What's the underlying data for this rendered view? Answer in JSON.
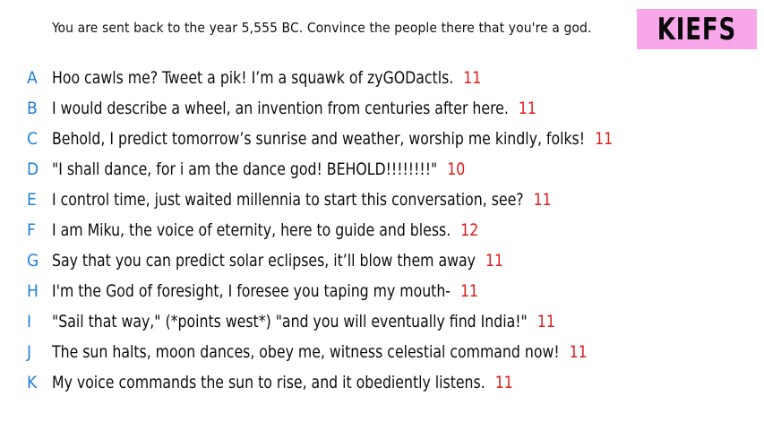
{
  "prompt": "You are sent back to the year 5,555 BC. Convince the people there that you're a god.",
  "badge": "KIEFS",
  "colors": {
    "letter": "#1f7fd9",
    "score": "#e01b1b",
    "badge_bg": "#f7a7ea"
  },
  "answers": [
    {
      "letter": "A",
      "text": "Hoo cawls me? Tweet a pik! I’m a squawk of zyGODactls.",
      "score": "11"
    },
    {
      "letter": "B",
      "text": "I would describe a wheel, an invention from centuries after here.",
      "score": "11"
    },
    {
      "letter": "C",
      "text": "Behold, I predict tomorrow’s sunrise and weather, worship me kindly, folks!",
      "score": "11"
    },
    {
      "letter": "D",
      "text": "\"I shall dance, for i am the dance god! BEHOLD!!!!!!!!\"",
      "score": "10"
    },
    {
      "letter": "E",
      "text": "I control time, just waited millennia to start this conversation, see?",
      "score": "11"
    },
    {
      "letter": "F",
      "text": "I am Miku, the voice of eternity, here to guide and bless.",
      "score": "12"
    },
    {
      "letter": "G",
      "text": "Say that you can predict solar eclipses, it’ll blow them away",
      "score": "11"
    },
    {
      "letter": "H",
      "text": "I'm the God of foresight, I foresee you taping my mouth-",
      "score": "11"
    },
    {
      "letter": "I",
      "text": "\"Sail that way,\" (*points west*) \"and you will eventually find India!\"",
      "score": "11"
    },
    {
      "letter": "J",
      "text": "The sun halts, moon dances, obey me, witness celestial command now!",
      "score": "11"
    },
    {
      "letter": "K",
      "text": "My voice commands the sun to rise, and it obediently listens.",
      "score": "11"
    }
  ]
}
